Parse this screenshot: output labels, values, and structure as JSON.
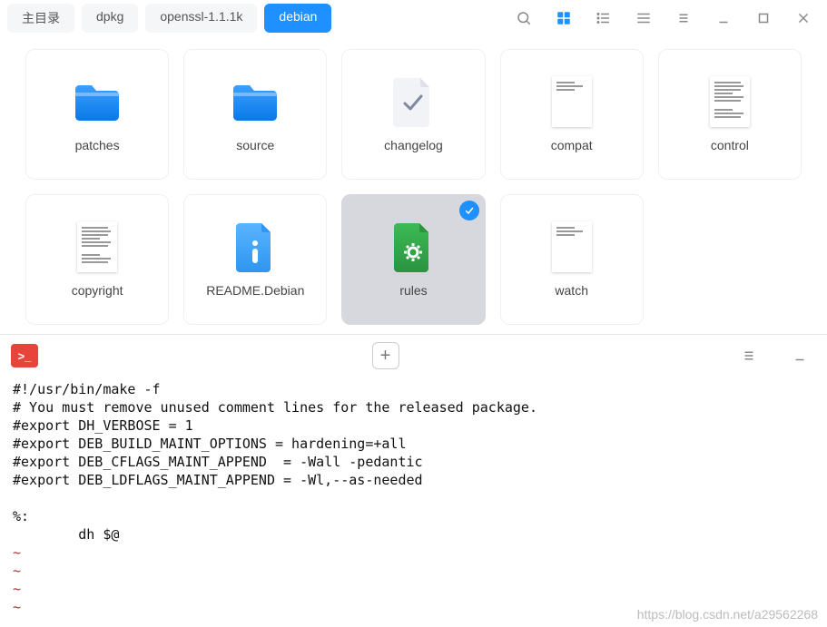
{
  "breadcrumb": [
    {
      "label": "主目录",
      "active": false
    },
    {
      "label": "dpkg",
      "active": false
    },
    {
      "label": "openssl-1.1.1k",
      "active": false
    },
    {
      "label": "debian",
      "active": true
    }
  ],
  "toolbar_icons": [
    "search",
    "grid",
    "list",
    "detail",
    "menu",
    "minimize",
    "maximize",
    "close"
  ],
  "files": [
    {
      "name": "patches",
      "kind": "folder"
    },
    {
      "name": "source",
      "kind": "folder"
    },
    {
      "name": "changelog",
      "kind": "check"
    },
    {
      "name": "compat",
      "kind": "doc-sparse"
    },
    {
      "name": "control",
      "kind": "doc"
    },
    {
      "name": "copyright",
      "kind": "doc"
    },
    {
      "name": "README.Debian",
      "kind": "info"
    },
    {
      "name": "rules",
      "kind": "gear",
      "selected": true
    },
    {
      "name": "watch",
      "kind": "doc-sparse"
    }
  ],
  "terminal": {
    "add_label": "+",
    "lines": [
      "#!/usr/bin/make -f",
      "# You must remove unused comment lines for the released package.",
      "#export DH_VERBOSE = 1",
      "#export DEB_BUILD_MAINT_OPTIONS = hardening=+all",
      "#export DEB_CFLAGS_MAINT_APPEND  = -Wall -pedantic",
      "#export DEB_LDFLAGS_MAINT_APPEND = -Wl,--as-needed",
      "",
      "%:",
      "        dh $@"
    ],
    "tilde_count": 4
  },
  "watermark": "https://blog.csdn.net/a29562268"
}
